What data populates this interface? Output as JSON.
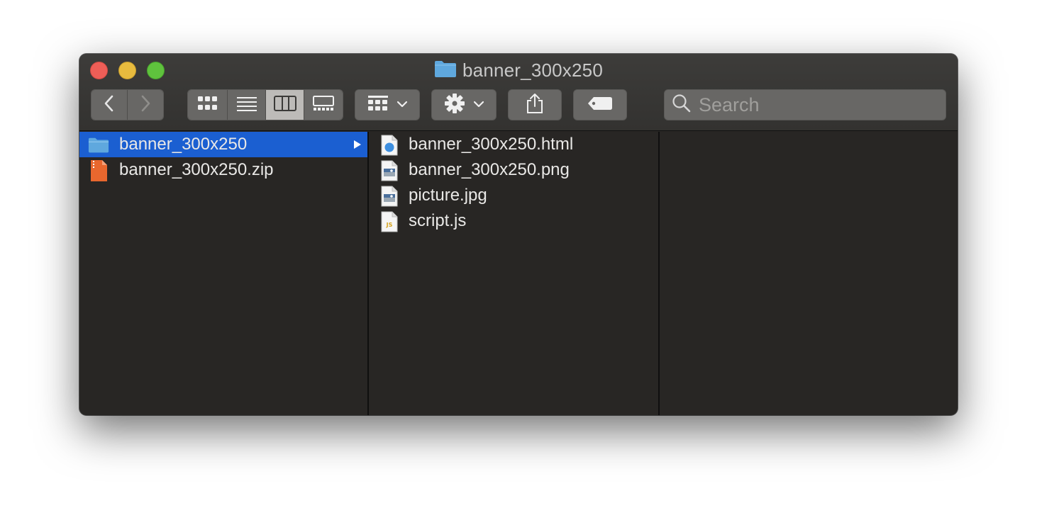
{
  "window": {
    "title": "banner_300x250"
  },
  "toolbar": {
    "back_icon": "chevron-left-icon",
    "forward_icon": "chevron-right-icon",
    "view_modes": [
      "icon-view",
      "list-view",
      "column-view",
      "gallery-view"
    ],
    "active_view": "column-view",
    "group_icon": "group-by-icon",
    "action_icon": "gear-icon",
    "share_icon": "share-icon",
    "tag_icon": "tag-icon"
  },
  "search": {
    "placeholder": "Search"
  },
  "column1": {
    "items": [
      {
        "label": "banner_300x250",
        "icon": "folder-icon",
        "selected": true
      },
      {
        "label": "banner_300x250.zip",
        "icon": "zip-file-icon",
        "selected": false
      }
    ]
  },
  "column2": {
    "items": [
      {
        "label": "banner_300x250.html",
        "icon": "html-file-icon"
      },
      {
        "label": "banner_300x250.png",
        "icon": "image-file-icon"
      },
      {
        "label": "picture.jpg",
        "icon": "image-file-icon"
      },
      {
        "label": "script.js",
        "icon": "js-file-icon"
      }
    ]
  },
  "colors": {
    "window_bg": "#282624",
    "selection": "#1b5fd1",
    "toolbar_button": "#686765",
    "folder": "#5fa8de",
    "close": "#ee5e57",
    "minimize": "#e8bb3e",
    "maximize": "#5fc23d"
  }
}
